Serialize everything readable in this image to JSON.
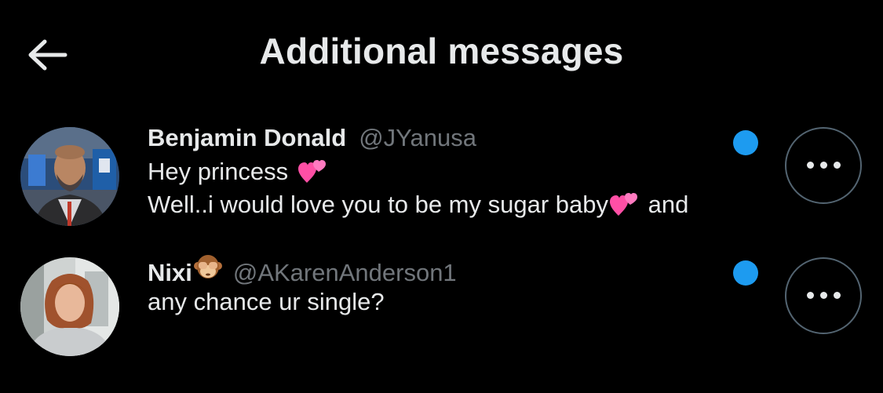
{
  "header": {
    "title": "Additional messages",
    "back_icon": "arrow-left-icon"
  },
  "colors": {
    "background": "#000000",
    "text_primary": "#e7e9ea",
    "text_secondary": "#71767b",
    "unread_dot": "#1d9bf0",
    "button_border": "#536471"
  },
  "messages": [
    {
      "name": "Benjamin Donald",
      "handle": "@JYanusa",
      "lines": [
        {
          "text": "Hey princess",
          "emoji": "two-hearts",
          "after": ""
        },
        {
          "text": "Well..i would love you to be my sugar baby",
          "emoji": "two-hearts",
          "after": " and"
        }
      ],
      "unread": true,
      "more_icon": "more-horizontal-icon"
    },
    {
      "name": "Nixi",
      "name_emoji": "see-no-evil-monkey",
      "handle": "@AKarenAnderson1",
      "lines": [
        {
          "text": "any chance ur single?"
        }
      ],
      "unread": true,
      "more_icon": "more-horizontal-icon"
    }
  ]
}
